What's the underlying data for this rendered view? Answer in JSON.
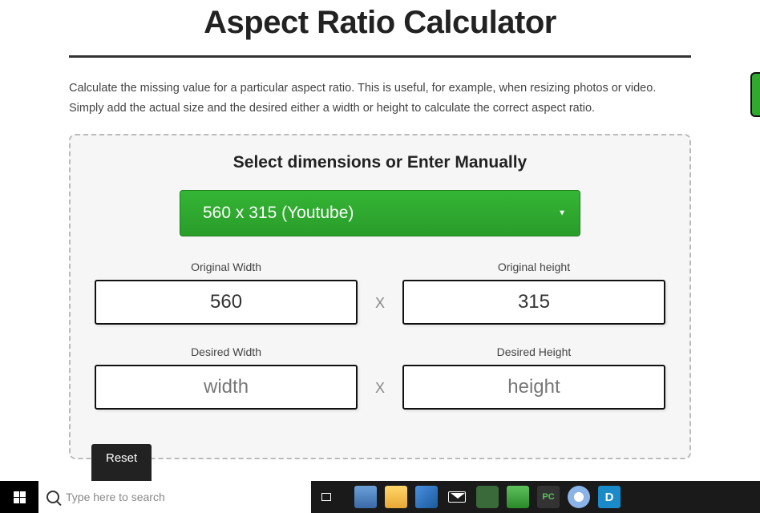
{
  "page": {
    "title": "Aspect Ratio Calculator",
    "description": "Calculate the missing value for a particular aspect ratio. This is useful, for example, when resizing photos or video. Simply add the actual size and the desired either a width or height to calculate the correct aspect ratio."
  },
  "panel": {
    "heading": "Select dimensions or Enter Manually",
    "preset_selected": "560 x 315 (Youtube)",
    "separator": "X",
    "original_width": {
      "label": "Original Width",
      "value": "560"
    },
    "original_height": {
      "label": "Original height",
      "value": "315"
    },
    "desired_width": {
      "label": "Desired Width",
      "placeholder": "width",
      "value": ""
    },
    "desired_height": {
      "label": "Desired Height",
      "placeholder": "height",
      "value": ""
    },
    "reset_label": "Reset"
  },
  "taskbar": {
    "search_placeholder": "Type here to search"
  },
  "colors": {
    "accent_green": "#2faa2f",
    "ink": "#222222"
  }
}
